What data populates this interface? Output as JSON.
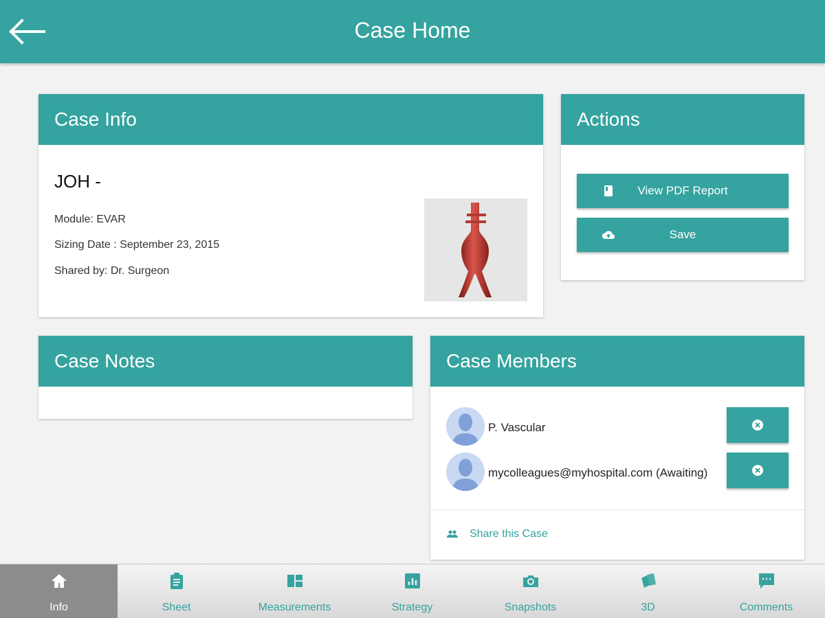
{
  "header": {
    "title": "Case Home",
    "back_icon": "back-arrow-icon"
  },
  "case_info": {
    "title": "Case Info",
    "patient": "JOH -",
    "module": "Module: EVAR",
    "sizing_date": "Sizing Date : September 23, 2015",
    "shared_by": "Shared by: Dr. Surgeon"
  },
  "actions": {
    "title": "Actions",
    "buttons": [
      {
        "label": "View PDF Report",
        "icon": "pdf-report-icon"
      },
      {
        "label": "Save",
        "icon": "cloud-upload-icon"
      }
    ]
  },
  "case_notes": {
    "title": "Case Notes"
  },
  "case_members": {
    "title": "Case Members",
    "members": [
      {
        "name": "P. Vascular"
      },
      {
        "name": "mycolleagues@myhospital.com (Awaiting)"
      }
    ],
    "share_label": "Share this Case"
  },
  "nav": {
    "items": [
      {
        "label": "Info",
        "icon": "home-icon",
        "active": true
      },
      {
        "label": "Sheet",
        "icon": "clipboard-icon"
      },
      {
        "label": "Measurements",
        "icon": "dashboard-icon"
      },
      {
        "label": "Strategy",
        "icon": "bar-chart-icon"
      },
      {
        "label": "Snapshots",
        "icon": "camera-icon"
      },
      {
        "label": "3D",
        "icon": "3d-cards-icon"
      },
      {
        "label": "Comments",
        "icon": "comment-icon"
      }
    ]
  },
  "colors": {
    "primary": "#35a39f",
    "background": "#f2f2f2",
    "nav_active": "#8c8c8c"
  }
}
